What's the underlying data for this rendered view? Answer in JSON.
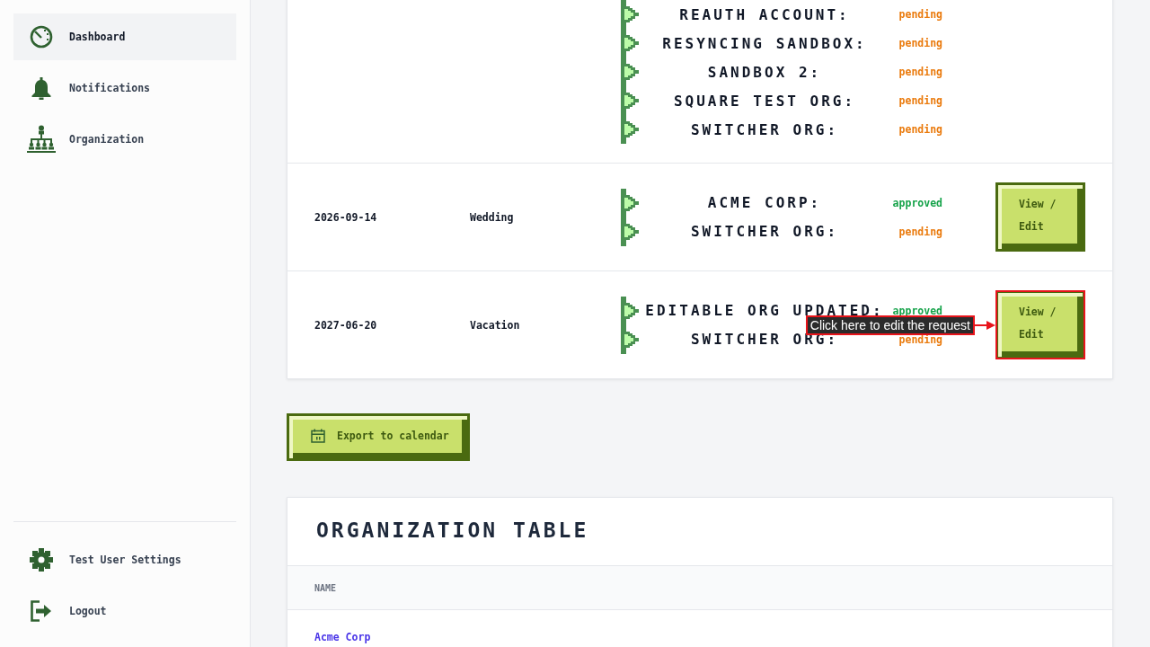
{
  "sidebar": {
    "items": [
      {
        "label": "Dashboard",
        "selected": true
      },
      {
        "label": "Notifications",
        "selected": false
      },
      {
        "label": "Organization",
        "selected": false
      }
    ],
    "footer_items": [
      {
        "label": "Test User Settings",
        "selected": false
      },
      {
        "label": "Logout",
        "selected": false
      }
    ]
  },
  "requests_table": {
    "rows": [
      {
        "organizations": [
          {
            "name": "REAUTH ACCOUNT:",
            "status": "pending",
            "color": "#ea7a0c"
          },
          {
            "name": "RESYNCING SANDBOX:",
            "status": "pending",
            "color": "#ea7a0c"
          },
          {
            "name": "SANDBOX 2:",
            "status": "pending",
            "color": "#ea7a0c"
          },
          {
            "name": "SQUARE TEST ORG:",
            "status": "pending",
            "color": "#ea7a0c"
          },
          {
            "name": "SWITCHER ORG:",
            "status": "pending",
            "color": "#ea7a0c"
          }
        ]
      },
      {
        "date": "2026-09-14",
        "type": "Wedding",
        "organizations": [
          {
            "name": "ACME CORP:",
            "status": "approved",
            "color": "#16a34a"
          },
          {
            "name": "SWITCHER ORG:",
            "status": "pending",
            "color": "#ea7a0c"
          }
        ],
        "action": {
          "label": "View / Edit",
          "highlighted": false
        }
      },
      {
        "date": "2027-06-20",
        "type": "Vacation",
        "organizations": [
          {
            "name": "EDITABLE ORG UPDATED:",
            "status": "approved",
            "color": "#16a34a"
          },
          {
            "name": "SWITCHER ORG:",
            "status": "pending",
            "color": "#ea7a0c"
          }
        ],
        "action": {
          "label": "View / Edit",
          "highlighted": true,
          "callout": "Click here to edit the request"
        }
      }
    ]
  },
  "export_button": {
    "label": "Export to calendar"
  },
  "organization_table": {
    "title": "ORGANIZATION TABLE",
    "columns": [
      "NAME"
    ],
    "rows": [
      {
        "name": "Acme Corp"
      }
    ]
  }
}
